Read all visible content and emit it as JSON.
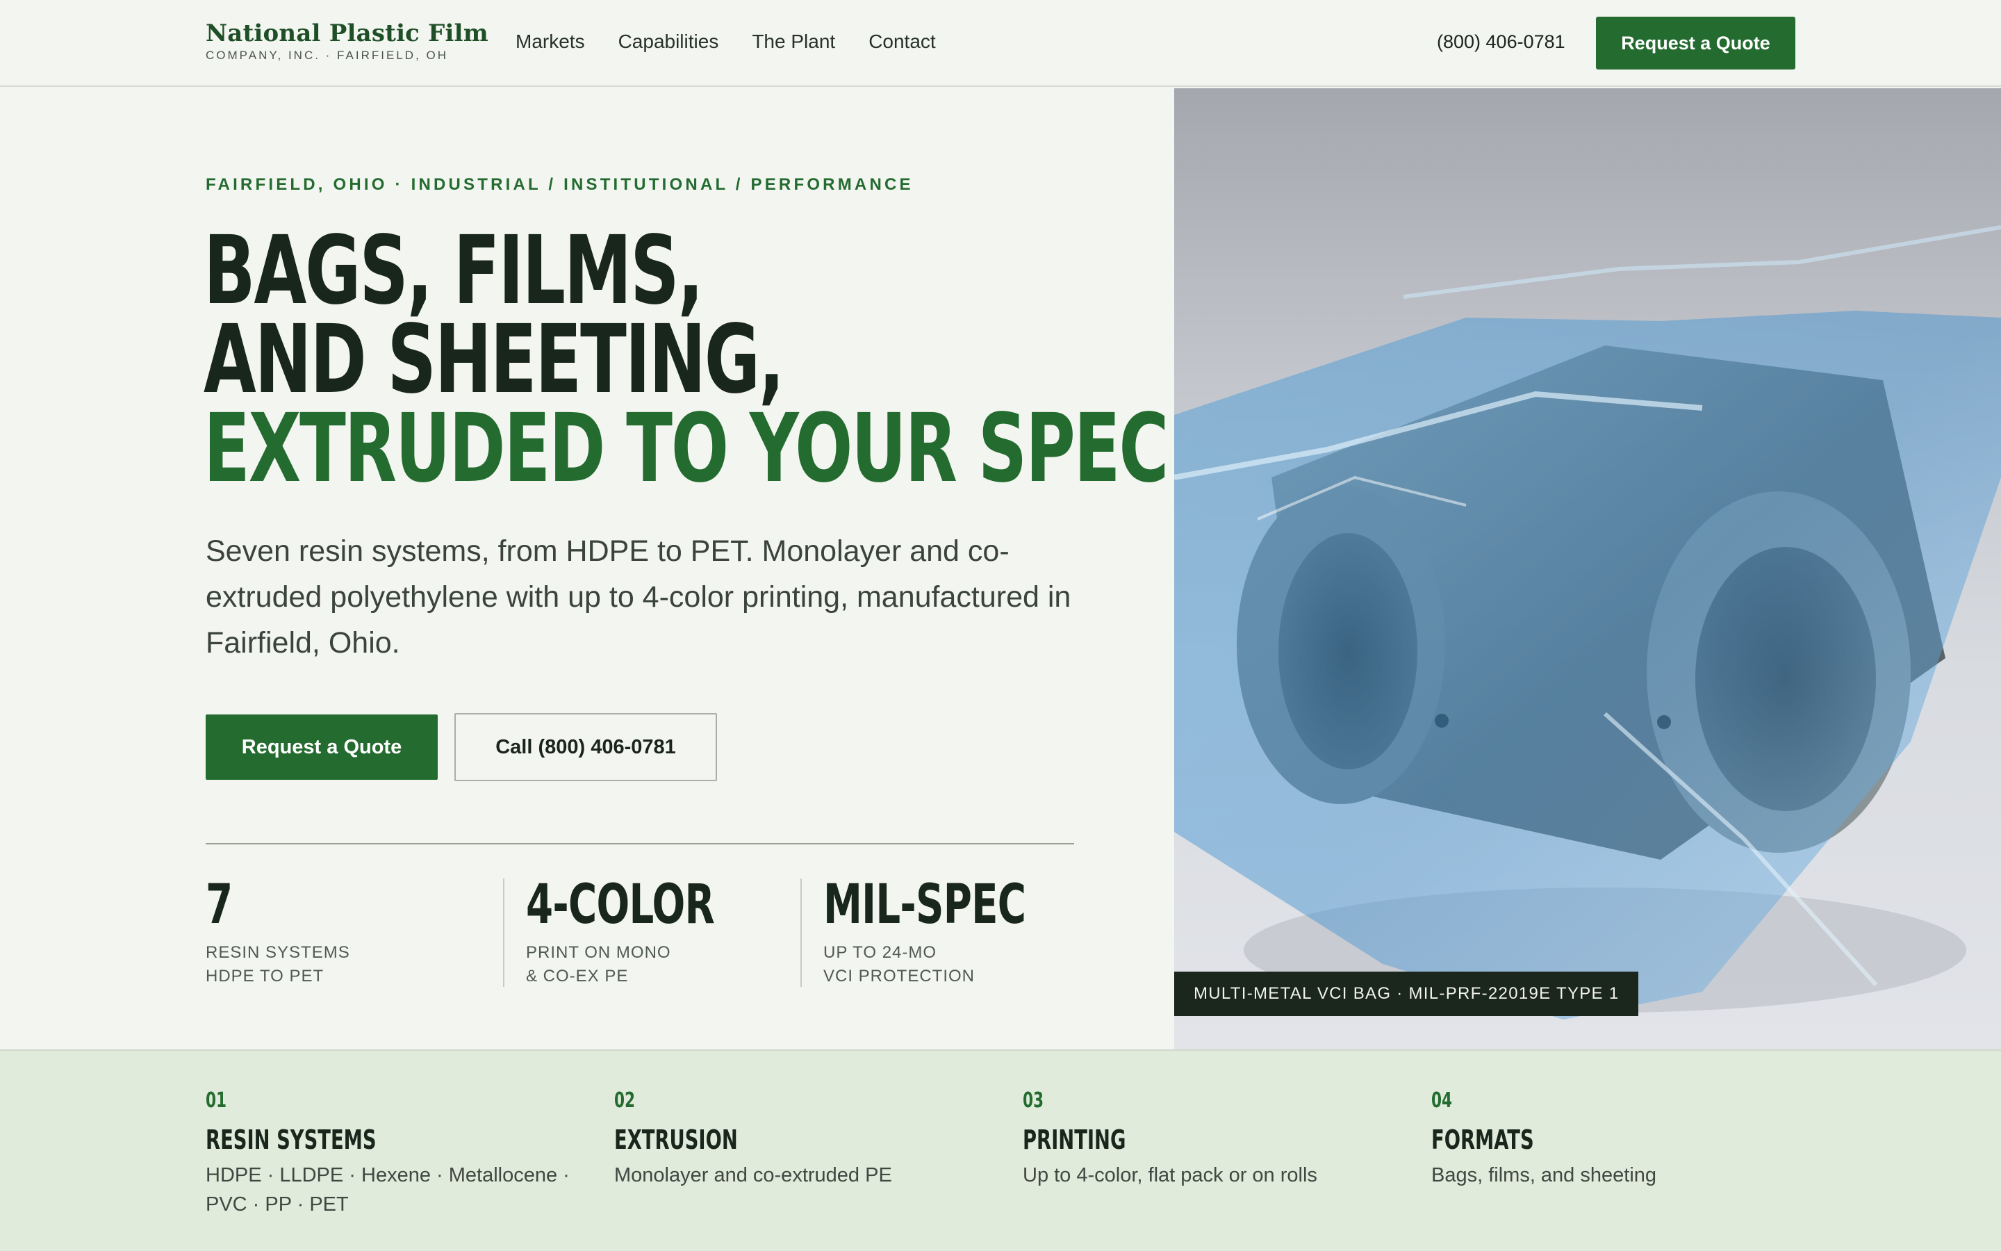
{
  "header": {
    "brand_name": "National Plastic Film",
    "brand_sub": "COMPANY, INC. · FAIRFIELD, OH",
    "nav": [
      "Markets",
      "Capabilities",
      "The Plant",
      "Contact"
    ],
    "phone": "(800) 406-0781",
    "quote_label": "Request a Quote"
  },
  "hero": {
    "eyebrow": "FAIRFIELD, OHIO · INDUSTRIAL / INSTITUTIONAL / PERFORMANCE",
    "headline_line1": "BAGS, FILMS,",
    "headline_line2": "AND SHEETING,",
    "headline_line3": "EXTRUDED TO YOUR SPEC.",
    "lede": "Seven resin systems, from HDPE to PET. Monolayer and co-extruded polyethylene with up to 4-color printing, manufactured in Fairfield, Ohio.",
    "quote_label": "Request a Quote",
    "call_label": "Call (800) 406-0781",
    "stats": [
      {
        "value": "7",
        "label1": "RESIN SYSTEMS",
        "label2": "HDPE TO PET"
      },
      {
        "value": "4-COLOR",
        "label1": "PRINT ON MONO",
        "label2": "& CO-EX PE"
      },
      {
        "value": "MIL-SPEC",
        "label1": "UP TO 24-MO",
        "label2": "VCI PROTECTION"
      }
    ],
    "image_caption": "MULTI-METAL VCI BAG · MIL-PRF-22019E TYPE 1"
  },
  "features": [
    {
      "num": "01",
      "title": "RESIN SYSTEMS",
      "desc": "HDPE · LLDPE · Hexene · Metallocene · PVC · PP · PET"
    },
    {
      "num": "02",
      "title": "EXTRUSION",
      "desc": "Monolayer and co-extruded PE"
    },
    {
      "num": "03",
      "title": "PRINTING",
      "desc": "Up to 4-color, flat pack or on rolls"
    },
    {
      "num": "04",
      "title": "FORMATS",
      "desc": "Bags, films, and sheeting"
    }
  ],
  "colors": {
    "brand_green": "#236b2f",
    "dark_text": "#18261b",
    "page_bg": "#f3f5f0",
    "band_bg": "#e1ebdb"
  }
}
